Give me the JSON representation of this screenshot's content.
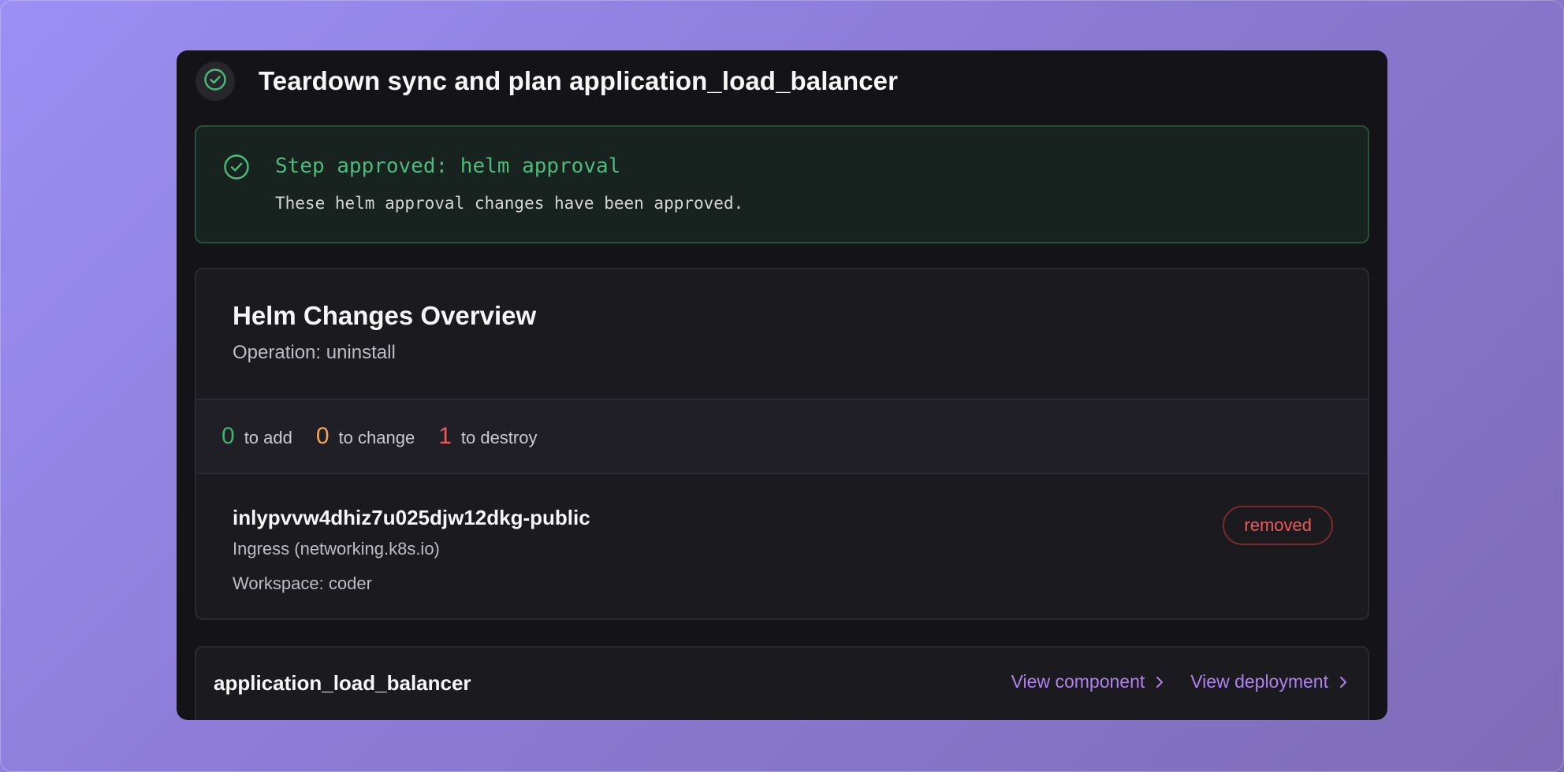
{
  "header": {
    "title": "Teardown sync and plan application_load_balancer",
    "status_icon": "check-circle-icon"
  },
  "approval": {
    "title": "Step approved: helm approval",
    "description": "These helm approval changes have been approved.",
    "icon": "check-circle-icon"
  },
  "helm": {
    "title": "Helm Changes Overview",
    "operation": "Operation: uninstall",
    "summary": {
      "add_count": "0",
      "add_label": "to add",
      "change_count": "0",
      "change_label": "to change",
      "destroy_count": "1",
      "destroy_label": "to destroy"
    },
    "resource": {
      "name": "inlypvvw4dhiz7u025djw12dkg-public",
      "kind": "Ingress (networking.k8s.io)",
      "workspace": "Workspace: coder",
      "status": "removed"
    }
  },
  "component": {
    "name": "application_load_balancer",
    "view_component": "View component",
    "view_deployment": "View deployment"
  },
  "colors": {
    "success": "#4cbb7c",
    "add": "#3fb170",
    "change": "#f1a556",
    "destroy": "#ef5a5a",
    "link": "#b082f0"
  }
}
